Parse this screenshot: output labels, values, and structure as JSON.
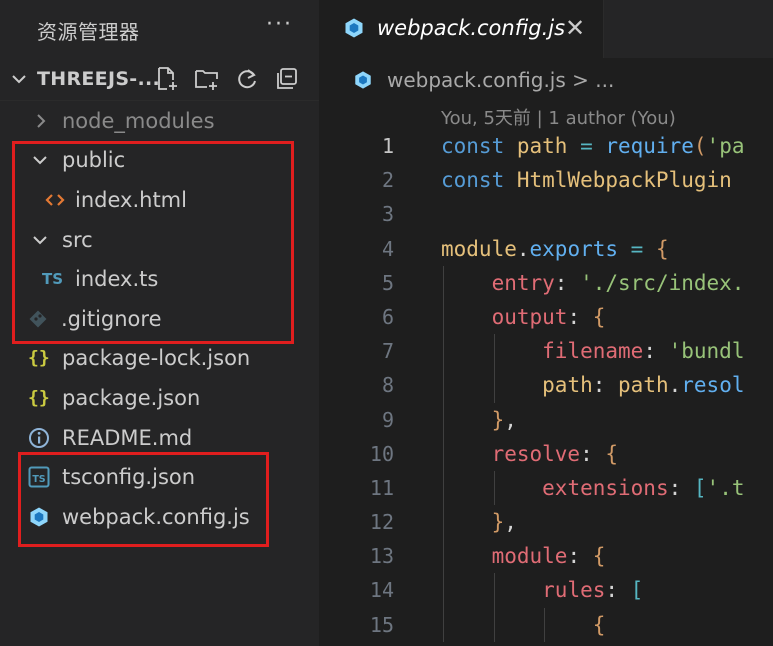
{
  "explorer": {
    "title": "资源管理器",
    "more": "···",
    "project": "THREEJS-...",
    "tree": [
      {
        "label": "node_modules",
        "icon": "chevron-right-icon",
        "kind": "folder-collapsed",
        "depth": 0,
        "dim": true
      },
      {
        "label": "public",
        "icon": "chevron-down-icon",
        "kind": "folder-expanded",
        "depth": 0
      },
      {
        "label": "index.html",
        "icon": "html-file-icon",
        "kind": "file",
        "depth": 1
      },
      {
        "label": "src",
        "icon": "chevron-down-icon",
        "kind": "folder-expanded",
        "depth": 0
      },
      {
        "label": "index.ts",
        "icon": "typescript-file-icon",
        "kind": "file",
        "depth": 1,
        "badge": "TS"
      },
      {
        "label": ".gitignore",
        "icon": "git-file-icon",
        "kind": "file",
        "depth": 0
      },
      {
        "label": "package-lock.json",
        "icon": "json-file-icon",
        "kind": "file",
        "depth": 0,
        "badge": "{}"
      },
      {
        "label": "package.json",
        "icon": "json-file-icon",
        "kind": "file",
        "depth": 0,
        "badge": "{}"
      },
      {
        "label": "README.md",
        "icon": "info-file-icon",
        "kind": "file",
        "depth": 0
      },
      {
        "label": "tsconfig.json",
        "icon": "tsconfig-file-icon",
        "kind": "file",
        "depth": 0
      },
      {
        "label": "webpack.config.js",
        "icon": "webpack-file-icon",
        "kind": "file",
        "depth": 0
      }
    ]
  },
  "editor": {
    "tab": {
      "label": "webpack.config.js",
      "close": "✕"
    },
    "breadcrumb": "webpack.config.js > ...",
    "codelens": "You, 5天前 | 1 author (You)",
    "active_line": 1,
    "lines": [
      {
        "n": "1",
        "tokens": [
          [
            "kw",
            "const "
          ],
          [
            "var",
            "path"
          ],
          [
            "op",
            " = "
          ],
          [
            "fn",
            "require"
          ],
          [
            "p",
            "("
          ],
          [
            "str",
            "'pa"
          ]
        ]
      },
      {
        "n": "2",
        "tokens": [
          [
            "kw",
            "const "
          ],
          [
            "var",
            "HtmlWebpackPlugin"
          ]
        ]
      },
      {
        "n": "3",
        "tokens": []
      },
      {
        "n": "4",
        "tokens": [
          [
            "var",
            "module"
          ],
          [
            "plain",
            "."
          ],
          [
            "fn",
            "exports"
          ],
          [
            "op",
            " = "
          ],
          [
            "p",
            "{"
          ]
        ]
      },
      {
        "n": "5",
        "tokens": [
          [
            "plain",
            "    "
          ],
          [
            "prop",
            "entry"
          ],
          [
            "plain",
            ": "
          ],
          [
            "str",
            "'./src/index."
          ]
        ]
      },
      {
        "n": "6",
        "tokens": [
          [
            "plain",
            "    "
          ],
          [
            "prop",
            "output"
          ],
          [
            "plain",
            ": "
          ],
          [
            "p",
            "{"
          ]
        ]
      },
      {
        "n": "7",
        "tokens": [
          [
            "plain",
            "        "
          ],
          [
            "prop",
            "filename"
          ],
          [
            "plain",
            ": "
          ],
          [
            "str",
            "'bundl"
          ]
        ]
      },
      {
        "n": "8",
        "tokens": [
          [
            "plain",
            "        "
          ],
          [
            "var",
            "path"
          ],
          [
            "plain",
            ": "
          ],
          [
            "var",
            "path"
          ],
          [
            "plain",
            "."
          ],
          [
            "fn",
            "resol"
          ]
        ]
      },
      {
        "n": "9",
        "tokens": [
          [
            "plain",
            "    "
          ],
          [
            "p",
            "}"
          ],
          [
            "plain",
            ","
          ]
        ]
      },
      {
        "n": "10",
        "tokens": [
          [
            "plain",
            "    "
          ],
          [
            "prop",
            "resolve"
          ],
          [
            "plain",
            ": "
          ],
          [
            "p",
            "{"
          ]
        ]
      },
      {
        "n": "11",
        "tokens": [
          [
            "plain",
            "        "
          ],
          [
            "prop",
            "extensions"
          ],
          [
            "plain",
            ": "
          ],
          [
            "op",
            "["
          ],
          [
            "str",
            "'.t"
          ]
        ]
      },
      {
        "n": "12",
        "tokens": [
          [
            "plain",
            "    "
          ],
          [
            "p",
            "}"
          ],
          [
            "plain",
            ","
          ]
        ]
      },
      {
        "n": "13",
        "tokens": [
          [
            "plain",
            "    "
          ],
          [
            "prop",
            "module"
          ],
          [
            "plain",
            ": "
          ],
          [
            "p",
            "{"
          ]
        ]
      },
      {
        "n": "14",
        "tokens": [
          [
            "plain",
            "        "
          ],
          [
            "prop",
            "rules"
          ],
          [
            "plain",
            ": "
          ],
          [
            "op",
            "["
          ]
        ]
      },
      {
        "n": "15",
        "tokens": [
          [
            "plain",
            "            "
          ],
          [
            "p",
            "{"
          ]
        ]
      }
    ]
  },
  "colors": {
    "highlight_box": "#e01e1e",
    "sidebar_bg": "#252526",
    "editor_bg": "#1e1e1e"
  }
}
